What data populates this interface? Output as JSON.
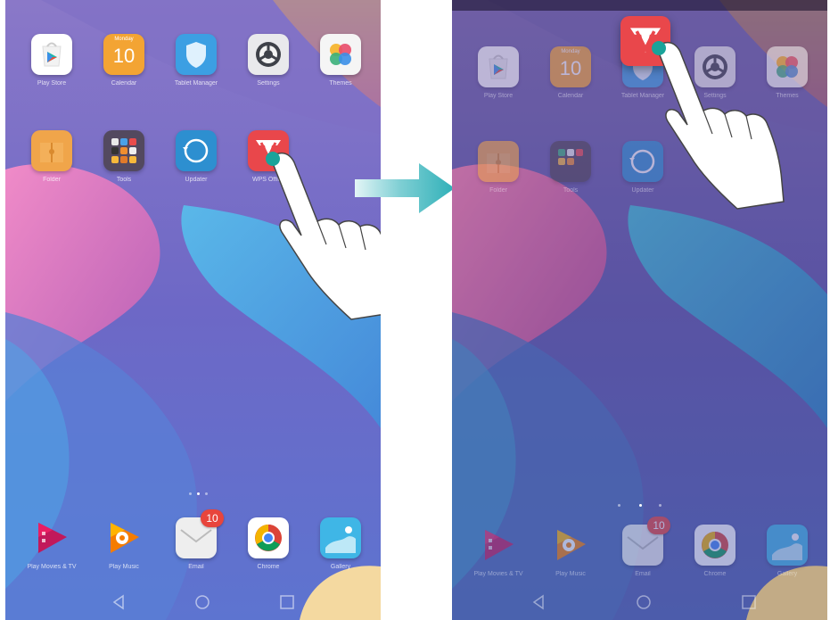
{
  "left_screen": {
    "grid": [
      {
        "label": "Play Store"
      },
      {
        "label": "Calendar",
        "day": "Monday",
        "date": "10"
      },
      {
        "label": "Tablet Manager"
      },
      {
        "label": "Settings"
      },
      {
        "label": "Themes"
      },
      {
        "label": "Folder"
      },
      {
        "label": "Tools"
      },
      {
        "label": "Updater"
      },
      {
        "label": "WPS Office"
      }
    ],
    "dock": [
      {
        "label": "Play Movies & TV"
      },
      {
        "label": "Play Music"
      },
      {
        "label": "Email",
        "badge": "10"
      },
      {
        "label": "Chrome"
      },
      {
        "label": "Gallery"
      }
    ]
  },
  "right_screen": {
    "grid": [
      {
        "label": "Play Store"
      },
      {
        "label": "Calendar",
        "day": "Monday",
        "date": "10"
      },
      {
        "label": "Tablet Manager"
      },
      {
        "label": "Settings"
      },
      {
        "label": "Themes"
      },
      {
        "label": "Folder"
      },
      {
        "label": "Tools"
      },
      {
        "label": "Updater"
      }
    ],
    "dragged_app": {
      "label": "WPS Office"
    },
    "dock": [
      {
        "label": "Play Movies & TV"
      },
      {
        "label": "Play Music"
      },
      {
        "label": "Email",
        "badge": "10"
      },
      {
        "label": "Chrome"
      },
      {
        "label": "Gallery"
      }
    ]
  },
  "icons": {
    "play_store": "play-store-icon",
    "calendar": "calendar-icon",
    "tablet_manager": "shield-icon",
    "settings": "gear-icon",
    "themes": "themes-icon",
    "folder": "envelope-folder-icon",
    "tools": "folder-grid-icon",
    "updater": "refresh-icon",
    "wps": "wps-icon",
    "movies": "movie-icon",
    "music": "music-icon",
    "email": "email-icon",
    "chrome": "chrome-icon",
    "gallery": "gallery-icon"
  },
  "colors": {
    "arrow": "#37b6bd",
    "touch_point": "#1aa39a",
    "badge": "#e8453c",
    "wps": "#e9474b",
    "calendar": "#f3a433",
    "folder": "#f0a54a"
  }
}
